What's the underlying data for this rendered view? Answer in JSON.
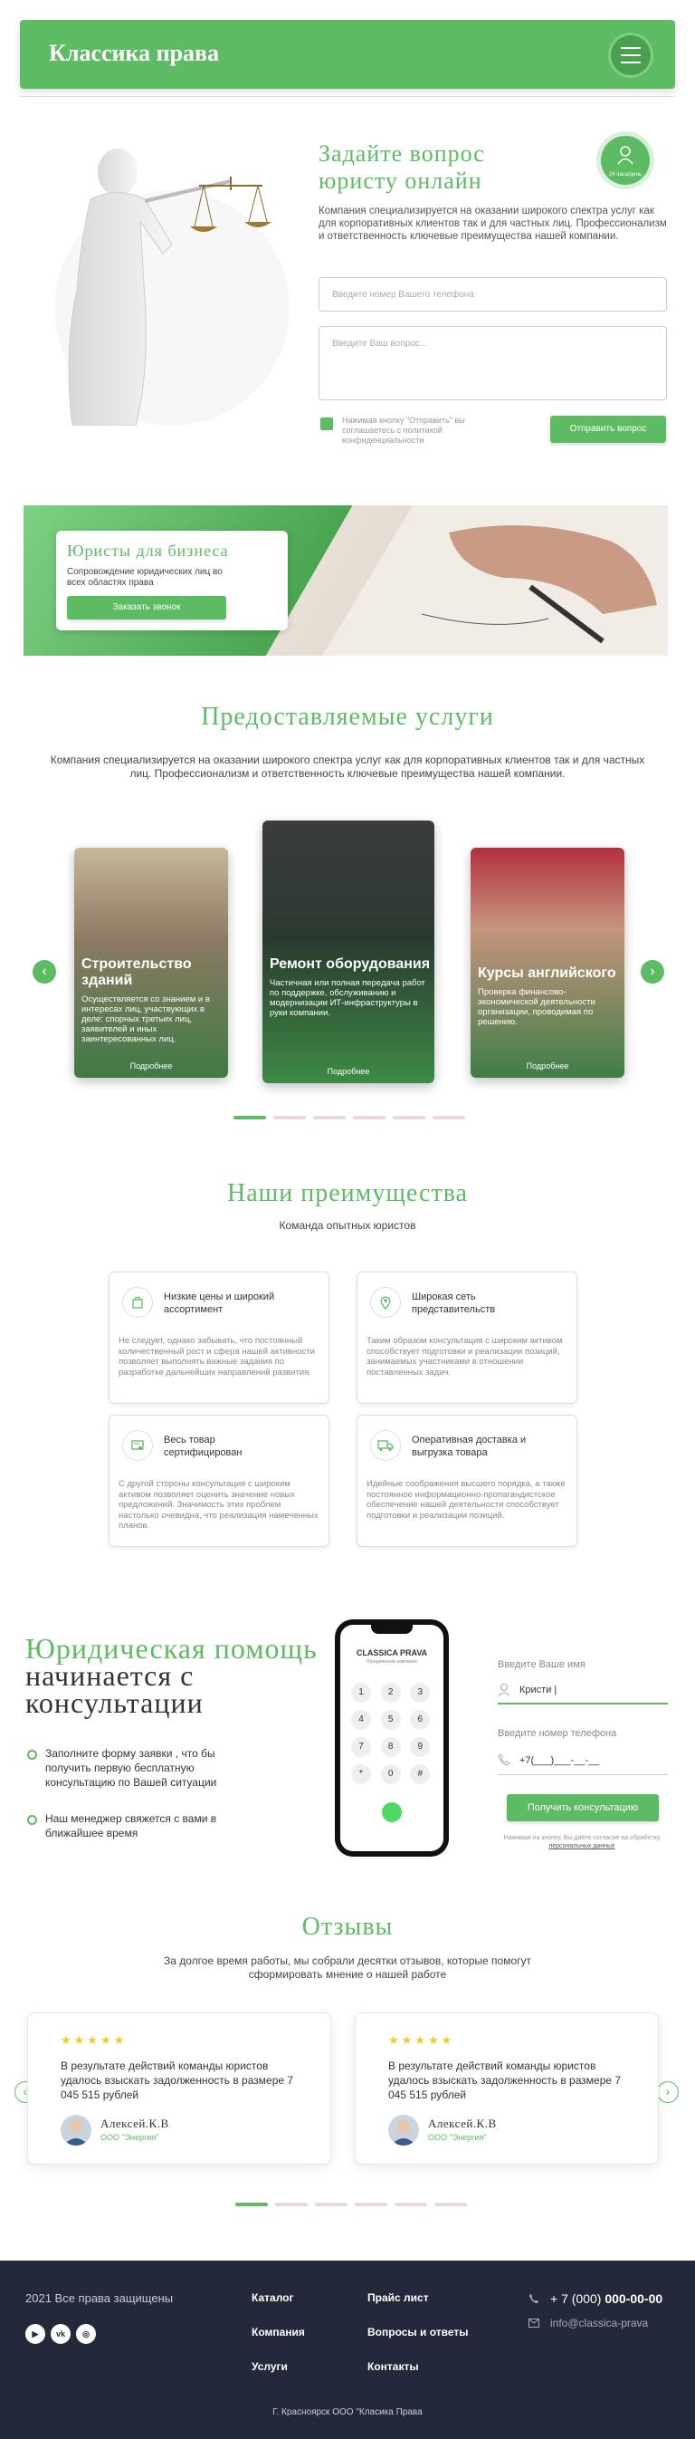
{
  "header": {
    "logo": "Классика права",
    "menu_icon": "hamburger-icon"
  },
  "hero": {
    "title": "Задайте вопрос юристу онлайн",
    "badge": "24 часа/день",
    "desc": "Компания специализируется на оказании широкого спектра услуг как для корпоративных клиентов так и для частных лиц. Профессионализм и ответственность ключевые преимущества нашей компании.",
    "phone_placeholder": "Введите номер Вашего телефона",
    "question_placeholder": "Введите Ваш вопрос...",
    "consent": "Нажимая кнопку \"Отправить\" вы соглашаетесь с политикой конфиденциальности",
    "send": "Отправить вопрос"
  },
  "business": {
    "title": "Юристы для бизнеса",
    "sub": "Сопровождение юридических лиц во всех областях права",
    "button": "Заказать звонок"
  },
  "services": {
    "title": "Предоставляемые услуги",
    "sub": "Компания специализируется на оказании широкого спектра услуг как для корпоративных клиентов так и для частных лиц. Профессионализм и ответственность ключевые преимущества нашей компании.",
    "cards": [
      {
        "title": "Строительство зданий",
        "text": "Осуществляется со знанием и в интересах лиц, участвующих в деле: спорных третьих лиц, заявителей и иных заинтересованных лиц.",
        "more": "Подробнее"
      },
      {
        "title": "Ремонт оборудования",
        "text": "Частичная или полная передача работ по поддержке, обслуживанию и модернизации ИТ-инфраструктуры в руки компании.",
        "more": "Подробнее"
      },
      {
        "title": "Курсы английского",
        "text": "Проверка финансово-экономической деятельности организации, проводимая по решению.",
        "more": "Подробнее"
      }
    ]
  },
  "advantages": {
    "title": "Наши преимущества",
    "sub": "Команда опытных юристов",
    "items": [
      {
        "title": "Низкие цены и широкий ассортимент",
        "text": "Не следует, однако забывать, что постоянный количественный рост и сфера нашей активности позволяет выполнять важные задания по разработке дальнейших направлений развития.",
        "icon": "shopping-bag-icon"
      },
      {
        "title": "Широкая сеть представительств",
        "text": "Таким образом консультация с широким активом способствует подготовки и реализации позиций, занимаемых участниками в отношении поставленных задач.",
        "icon": "location-pin-icon"
      },
      {
        "title": "Весь товар сертифицирован",
        "text": "С другой стороны консультация с широким активом позволяет оценить значение новых предложений. Значимость этих проблем настолько очевидна, что реализация намеченных планов.",
        "icon": "certificate-icon"
      },
      {
        "title": "Оперативная доставка и выгрузка товара",
        "text": "Идейные соображения высшего порядка, а также постоянное информационно-пропагандистское обеспечение нашей деятельности способствует подготовки и реализации позиций.",
        "icon": "truck-icon"
      }
    ]
  },
  "consult": {
    "title_green": "Юридическая помощь",
    "title_rest": "начинается с консультации",
    "points": [
      "Заполните форму заявки , что бы получить первую бесплатную консультацию по Вашей ситуации",
      "Наш менеджер свяжется с вами в ближайшее время"
    ],
    "phone_title": "CLASSICA PRAVA",
    "phone_sub": "Юридическая компания",
    "keys": [
      "1",
      "2",
      "3",
      "4",
      "5",
      "6",
      "7",
      "8",
      "9",
      "*",
      "0",
      "#"
    ],
    "name_label": "Введите Ваше имя",
    "name_value": "Кристи |",
    "phone_label": "Введите номер телефона",
    "phone_value": "+7(___)___-__-__",
    "button": "Получить консультацию",
    "policy_text": "Нажимая на кнопку, Вы даёте согласие на обработку",
    "policy_link": "персональных данных"
  },
  "reviews": {
    "title": "Отзывы",
    "sub": "За долгое время работы, мы собрали десятки отзывов, которые помогут сформировать мнение о нашей работе",
    "items": [
      {
        "stars": "★★★★★",
        "text": "В результате действий команды юристов удалось взыскать задолженность в размере 7 045 515 рублей",
        "name": "Алексей.К.В",
        "company": "ООО \"Энергия\""
      },
      {
        "stars": "★★★★★",
        "text": "В результате действий команды юристов удалось взыскать задолженность в размере 7 045 515 рублей",
        "name": "Алексей.К.В",
        "company": "ООО \"Энергия\""
      }
    ]
  },
  "footer": {
    "copy": "2021 Все права защищены",
    "social": [
      "youtube-icon",
      "vk-icon",
      "instagram-icon"
    ],
    "links": [
      "Каталог",
      "Компания",
      "Услуги",
      "Прайс лист",
      "Вопросы и ответы",
      "Контакты"
    ],
    "phone_prefix": "+ 7 (000) ",
    "phone_main": "000-00-00",
    "email": "info@classica-prava",
    "address": "Г. Красноярск  ООО \"Класика Права"
  },
  "colors": {
    "accent": "#5dbb63",
    "footer": "#23293a"
  }
}
